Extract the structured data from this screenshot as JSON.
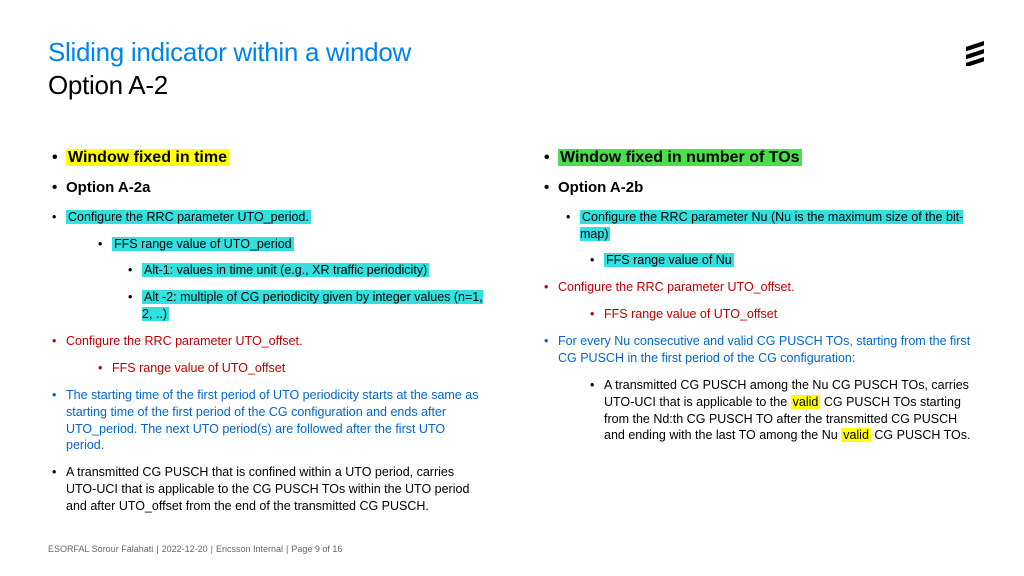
{
  "title": "Sliding indicator within a window",
  "subtitle": "Option A-2",
  "left": {
    "h1": "Window fixed in time",
    "h2": "Option A-2a",
    "i1": "Configure the RRC parameter UTO_period.",
    "i2": "FFS range value of UTO_period",
    "i3": "Alt-1: values in time unit (e.g., XR traffic periodicity)",
    "i4": "Alt -2: multiple of CG periodicity given by integer values (n=1, 2, ..)",
    "i5": "Configure the RRC parameter UTO_offset.",
    "i6": "FFS range value of UTO_offset",
    "i7": "The starting time of the first period of UTO periodicity starts at the same as starting time of the first period of the CG configuration and ends after UTO_period. The next UTO period(s) are followed after the first UTO period.",
    "i8": "A transmitted CG PUSCH that is confined within a UTO period, carries UTO-UCI that is applicable to the CG PUSCH TOs within the UTO period and after UTO_offset from the end of the transmitted CG PUSCH."
  },
  "right": {
    "h1": "Window fixed in number of TOs",
    "h2": "Option A-2b",
    "i1": "Configure the RRC parameter Nu (Nu is the maximum size of the bit-map)",
    "i2": "FFS range value of Nu",
    "i3": "Configure the RRC parameter UTO_offset.",
    "i4": "FFS range value of UTO_offset",
    "i5a": "For every Nu consecutive and valid CG PUSCH TOs, starting from the first CG PUSCH in the first period of the CG configuration:",
    "i6a": "A transmitted CG PUSCH among the Nu CG PUSCH TOs, carries UTO-UCI that is applicable to the ",
    "valid1": "valid",
    "i6b": " CG PUSCH TOs starting from the Nd:th CG PUSCH TO after the transmitted CG PUSCH and ending with the last TO among the Nu ",
    "valid2": "valid",
    "i6c": " CG PUSCH TOs."
  },
  "footer": {
    "author": "ESORFAL Sorour Falahati",
    "date": "2022-12-20",
    "class": "Ericsson Internal",
    "page": "Page 9 of 16"
  }
}
